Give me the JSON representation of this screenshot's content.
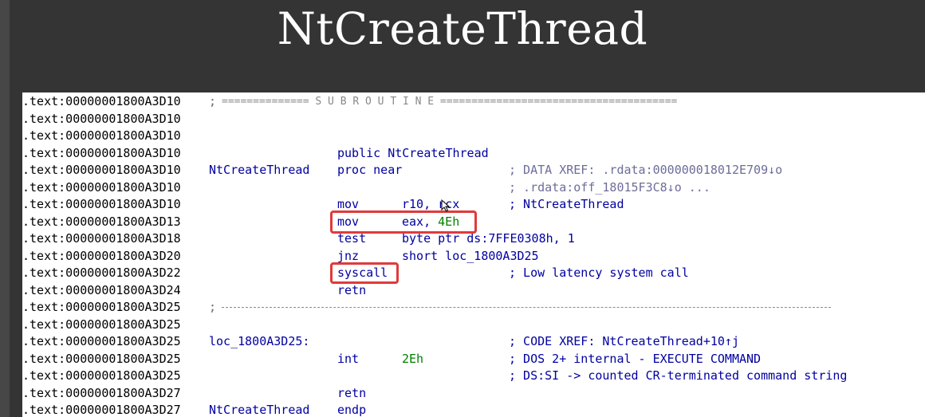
{
  "slide": {
    "title": "NtCreateThread"
  },
  "listing": {
    "lines": [
      {
        "addr": ".text:00000001800A3D10",
        "sep": ";",
        "sep_text": "============== S U B R O U T I N E ======================================"
      },
      {
        "addr": ".text:00000001800A3D10"
      },
      {
        "addr": ".text:00000001800A3D10"
      },
      {
        "addr": ".text:00000001800A3D10",
        "op": "public NtCreateThread"
      },
      {
        "addr": ".text:00000001800A3D10",
        "label": "NtCreateThread",
        "op": "proc near",
        "cmt": "; DATA XREF: .rdata:000000018012E709↓o"
      },
      {
        "addr": ".text:00000001800A3D10",
        "cmt": "; .rdata:off_18015F3C8↓o ..."
      },
      {
        "addr": ".text:00000001800A3D10",
        "op": "mov",
        "args": "r10, rcx",
        "cmt": "; NtCreateThread"
      },
      {
        "addr": ".text:00000001800A3D13",
        "op": "mov",
        "args_pre": "eax, ",
        "args_num": "4Eh"
      },
      {
        "addr": ".text:00000001800A3D18",
        "op": "test",
        "args_pre": "byte ptr ds:7FFE0308h, ",
        "args_num": "1"
      },
      {
        "addr": ".text:00000001800A3D20",
        "op": "jnz",
        "args": "short loc_1800A3D25"
      },
      {
        "addr": ".text:00000001800A3D22",
        "op": "syscall",
        "cmt": "; Low latency system call"
      },
      {
        "addr": ".text:00000001800A3D24",
        "op": "retn"
      },
      {
        "addr": ".text:00000001800A3D25",
        "sep": ";"
      },
      {
        "addr": ".text:00000001800A3D25"
      },
      {
        "addr": ".text:00000001800A3D25",
        "label": "loc_1800A3D25:",
        "cmt": "; CODE XREF: NtCreateThread+10↑j"
      },
      {
        "addr": ".text:00000001800A3D25",
        "op": "int",
        "args_num": "2Eh",
        "cmt": "; DOS 2+ internal - EXECUTE COMMAND"
      },
      {
        "addr": ".text:00000001800A3D25",
        "cmt": "; DS:SI -> counted CR-terminated command string"
      },
      {
        "addr": ".text:00000001800A3D27",
        "op": "retn"
      },
      {
        "addr": ".text:00000001800A3D27",
        "label": "NtCreateThread",
        "op": "endp"
      }
    ]
  },
  "highlights": {
    "color": "#e03a3a",
    "targets": [
      "mov eax, 4Eh",
      "syscall"
    ]
  }
}
